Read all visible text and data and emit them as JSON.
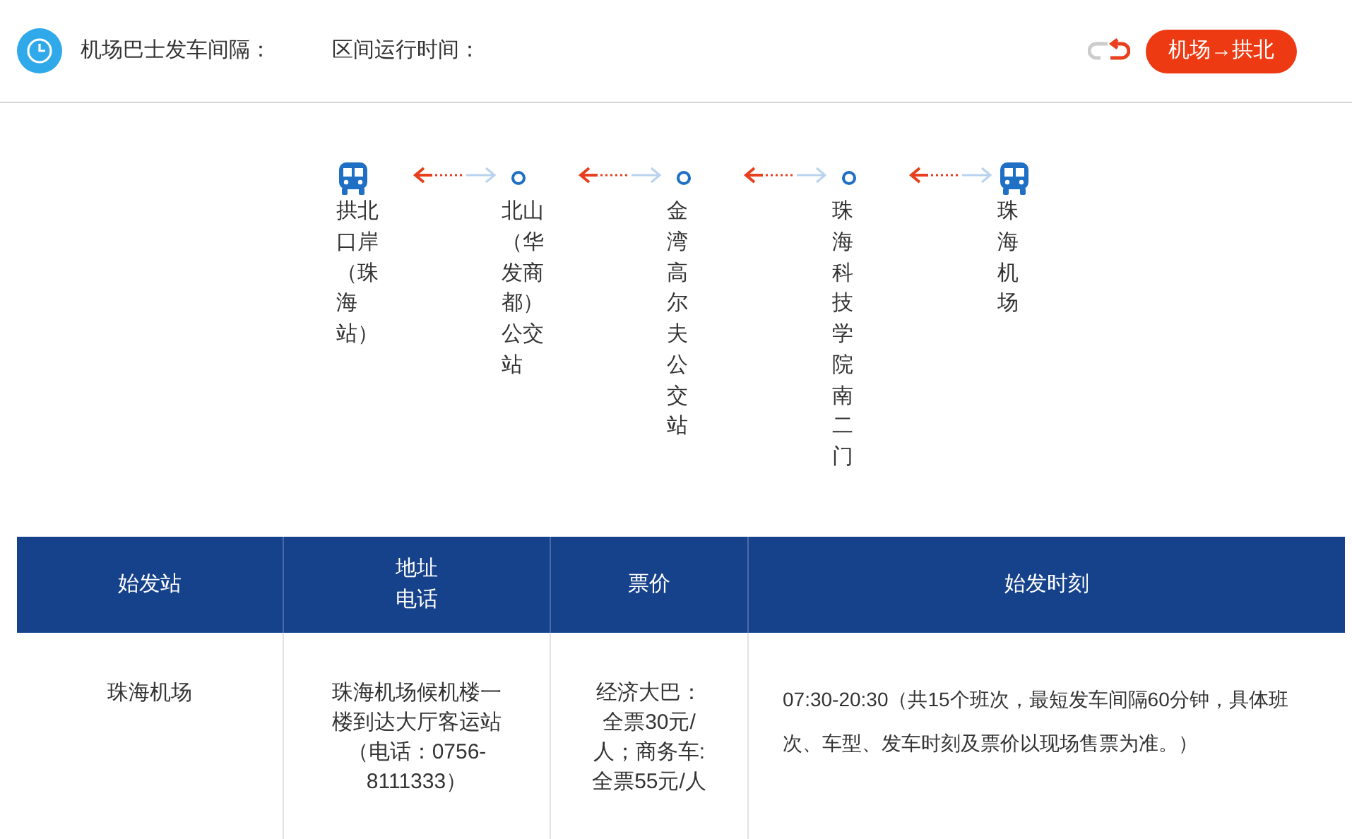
{
  "header": {
    "interval_label": "机场巴士发车间隔：",
    "duration_label": "区间运行时间：",
    "direction_button": "机场→拱北"
  },
  "stops": [
    {
      "kind": "terminal",
      "name": "拱北口岸（珠海站）"
    },
    {
      "kind": "stop",
      "name": "北山（华发商都）公交站"
    },
    {
      "kind": "stop",
      "name": "金湾高尔夫公交站"
    },
    {
      "kind": "stop",
      "name": "珠海科技学院南二门"
    },
    {
      "kind": "terminal",
      "name": "珠海机场"
    }
  ],
  "table": {
    "columns": [
      "始发站",
      [
        "地址",
        "电话"
      ],
      "票价",
      "始发时刻"
    ],
    "rows": [
      [
        "珠海机场",
        "珠海机场候机楼一楼到达大厅客运站（电话：0756-8111333）",
        "经济大巴：全票30元/人；商务车:全票55元/人",
        "07:30-20:30（共15个班次，最短发车间隔60分钟，具体班次、车型、发车时刻及票价以现场售票为准。）"
      ]
    ]
  }
}
